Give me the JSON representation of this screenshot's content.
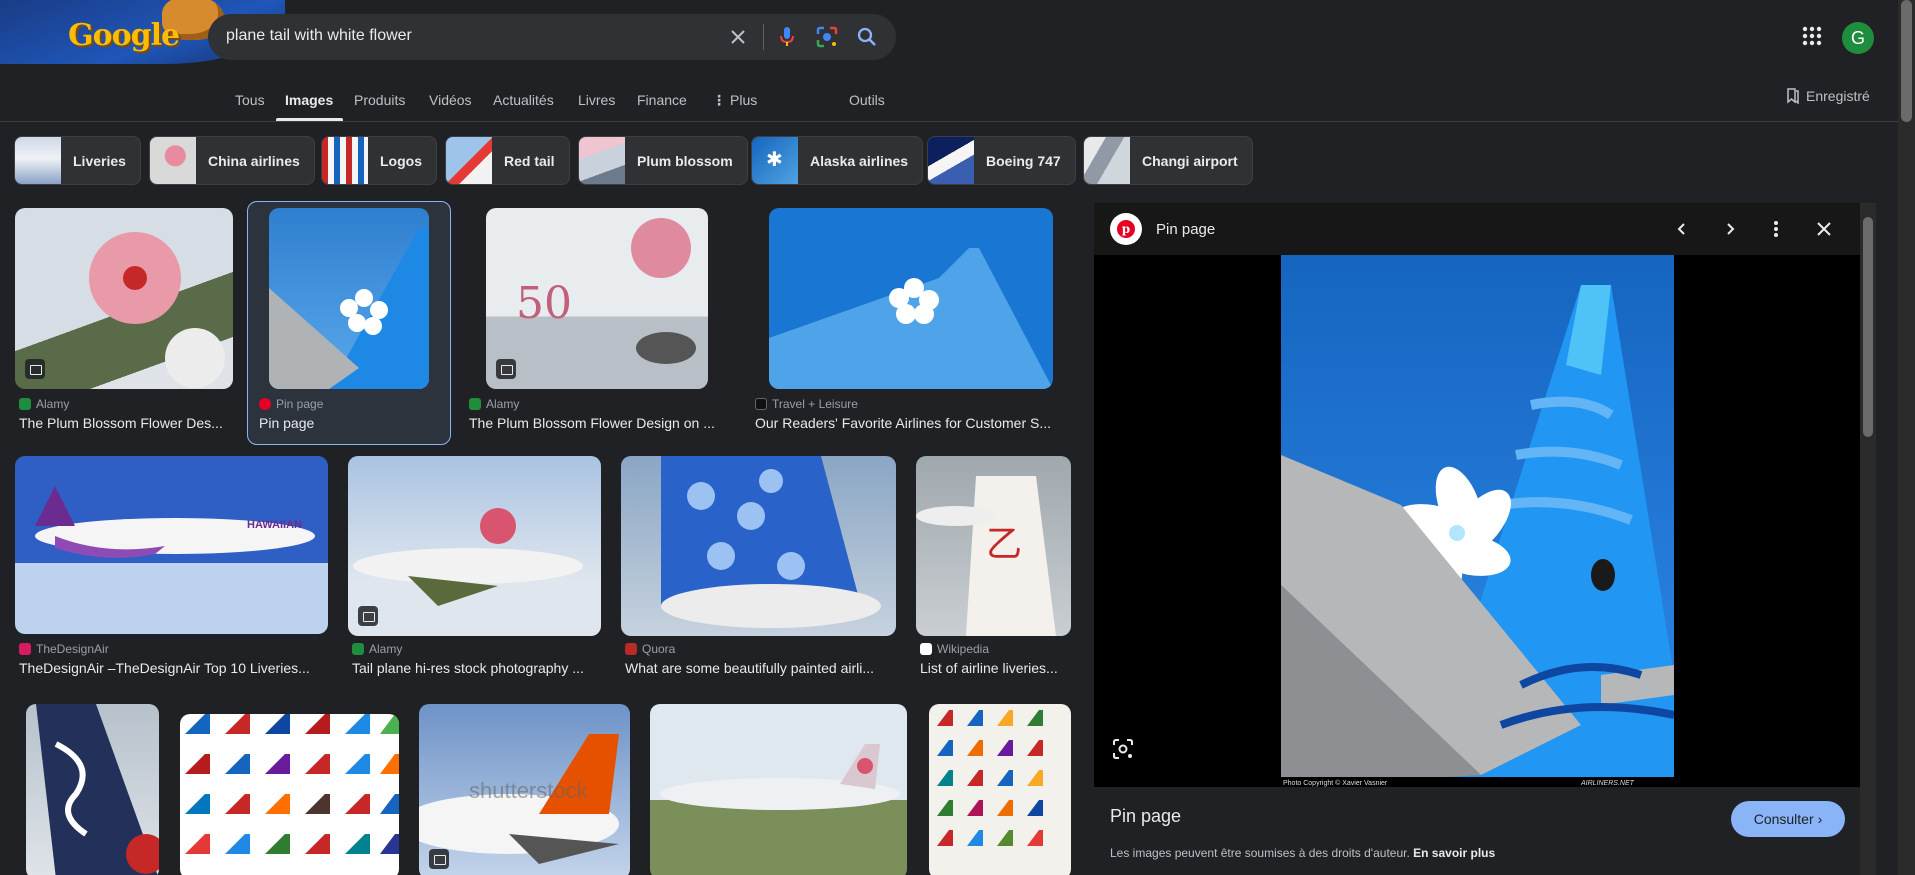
{
  "search": {
    "query": "plane tail with white flower"
  },
  "header": {
    "avatar_letter": "G",
    "logo_text": "Google"
  },
  "tabs": [
    {
      "label": "Tous"
    },
    {
      "label": "Images",
      "active": true
    },
    {
      "label": "Produits"
    },
    {
      "label": "Vidéos"
    },
    {
      "label": "Actualités"
    },
    {
      "label": "Livres"
    },
    {
      "label": "Finance"
    },
    {
      "label": "Plus"
    },
    {
      "label": "Outils"
    }
  ],
  "saved_label": "Enregistré",
  "chips": [
    {
      "label": "Liveries"
    },
    {
      "label": "China airlines"
    },
    {
      "label": "Logos"
    },
    {
      "label": "Red tail"
    },
    {
      "label": "Plum blossom"
    },
    {
      "label": "Alaska airlines"
    },
    {
      "label": "Boeing 747"
    },
    {
      "label": "Changi airport"
    }
  ],
  "results": [
    {
      "source": "Alamy",
      "title": "The Plum Blossom Flower Des..."
    },
    {
      "source": "Pin page",
      "title": "Pin page"
    },
    {
      "source": "Alamy",
      "title": "The Plum Blossom Flower Design on ..."
    },
    {
      "source": "Travel + Leisure",
      "title": "Our Readers' Favorite Airlines for Customer S..."
    },
    {
      "source": "TheDesignAir",
      "title": "TheDesignAir –TheDesignAir Top 10 Liveries..."
    },
    {
      "source": "Alamy",
      "title": "Tail plane hi-res stock photography ..."
    },
    {
      "source": "Quora",
      "title": "What are some beautifully painted airli..."
    },
    {
      "source": "Wikipedia",
      "title": "List of airline liveries..."
    }
  ],
  "image_text": {
    "shutterstock": "shutterstock",
    "hawaiian": "HAWAIIAN",
    "photo_copyright": "Photo Copyright © Xavier Vasnier",
    "airliners": "AIRLINERS.NET"
  },
  "preview": {
    "header_title": "Pin page",
    "title": "Pin page",
    "visit_label": "Consulter",
    "copyright_text": "Les images peuvent être soumises à des droits d'auteur.",
    "learn_more": "En savoir plus"
  },
  "colors": {
    "accent": "#8ab4f8",
    "background": "#202124",
    "pinterest": "#e60023"
  }
}
